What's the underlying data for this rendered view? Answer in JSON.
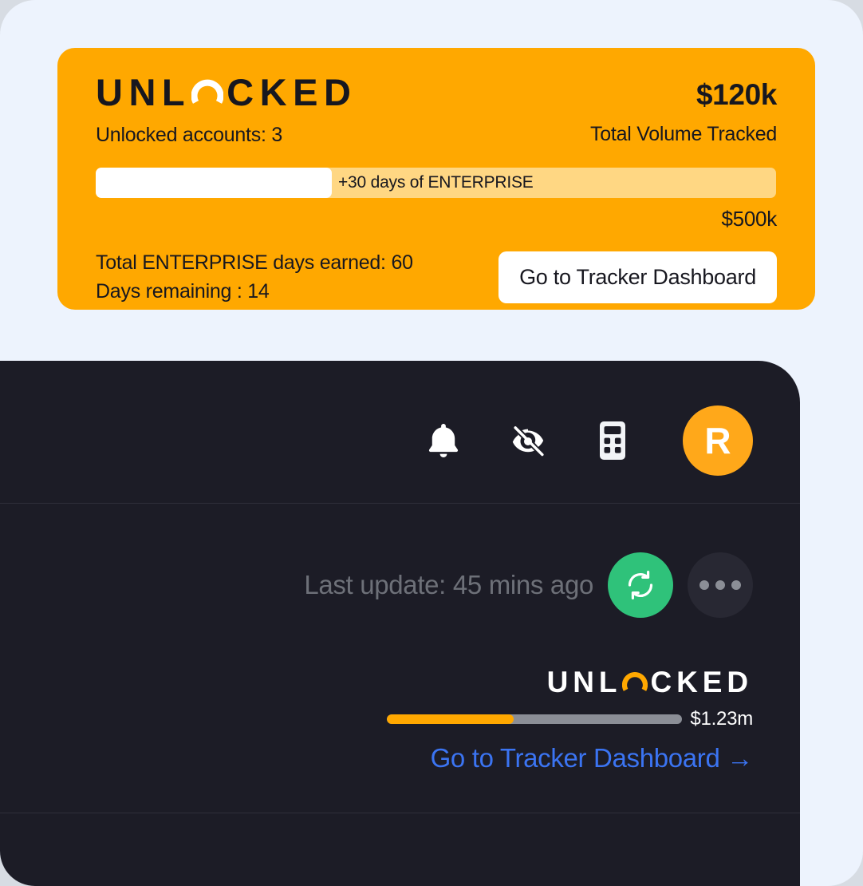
{
  "brand": {
    "name_part1": "UNL",
    "name_part2": "CKED",
    "ring_icon": "unlocked-ring-icon",
    "accent_color": "#FFA800",
    "dark_color": "#1C1C26",
    "link_color": "#3B74F2",
    "success_color": "#2FC27A"
  },
  "promo_card": {
    "accounts_label": "Unlocked accounts: 3",
    "volume_amount": "$120k",
    "volume_label": "Total Volume Tracked",
    "progress": {
      "fill_percent": 34.7,
      "reward_label": "+30 days of ENTERPRISE",
      "max_label": "$500k"
    },
    "stats": [
      "Total ENTERPRISE days earned: 60",
      "Days remaining : 14"
    ],
    "cta_label": "Go to Tracker Dashboard"
  },
  "app_panel": {
    "header_icons": [
      {
        "name": "bell-icon",
        "label": "Notifications"
      },
      {
        "name": "eye-off-icon",
        "label": "Hide balances"
      },
      {
        "name": "calculator-icon",
        "label": "Calculator"
      }
    ],
    "avatar_initial": "R",
    "update_row": {
      "status_text": "Last update: 45 mins ago",
      "refresh_icon": "refresh-sync-icon",
      "more_icon": "more-dots-icon"
    },
    "tracker": {
      "bar_fill_percent": 43,
      "bar_value": "$1.23m",
      "link_label": "Go to Tracker Dashboard",
      "link_arrow": "→"
    }
  }
}
